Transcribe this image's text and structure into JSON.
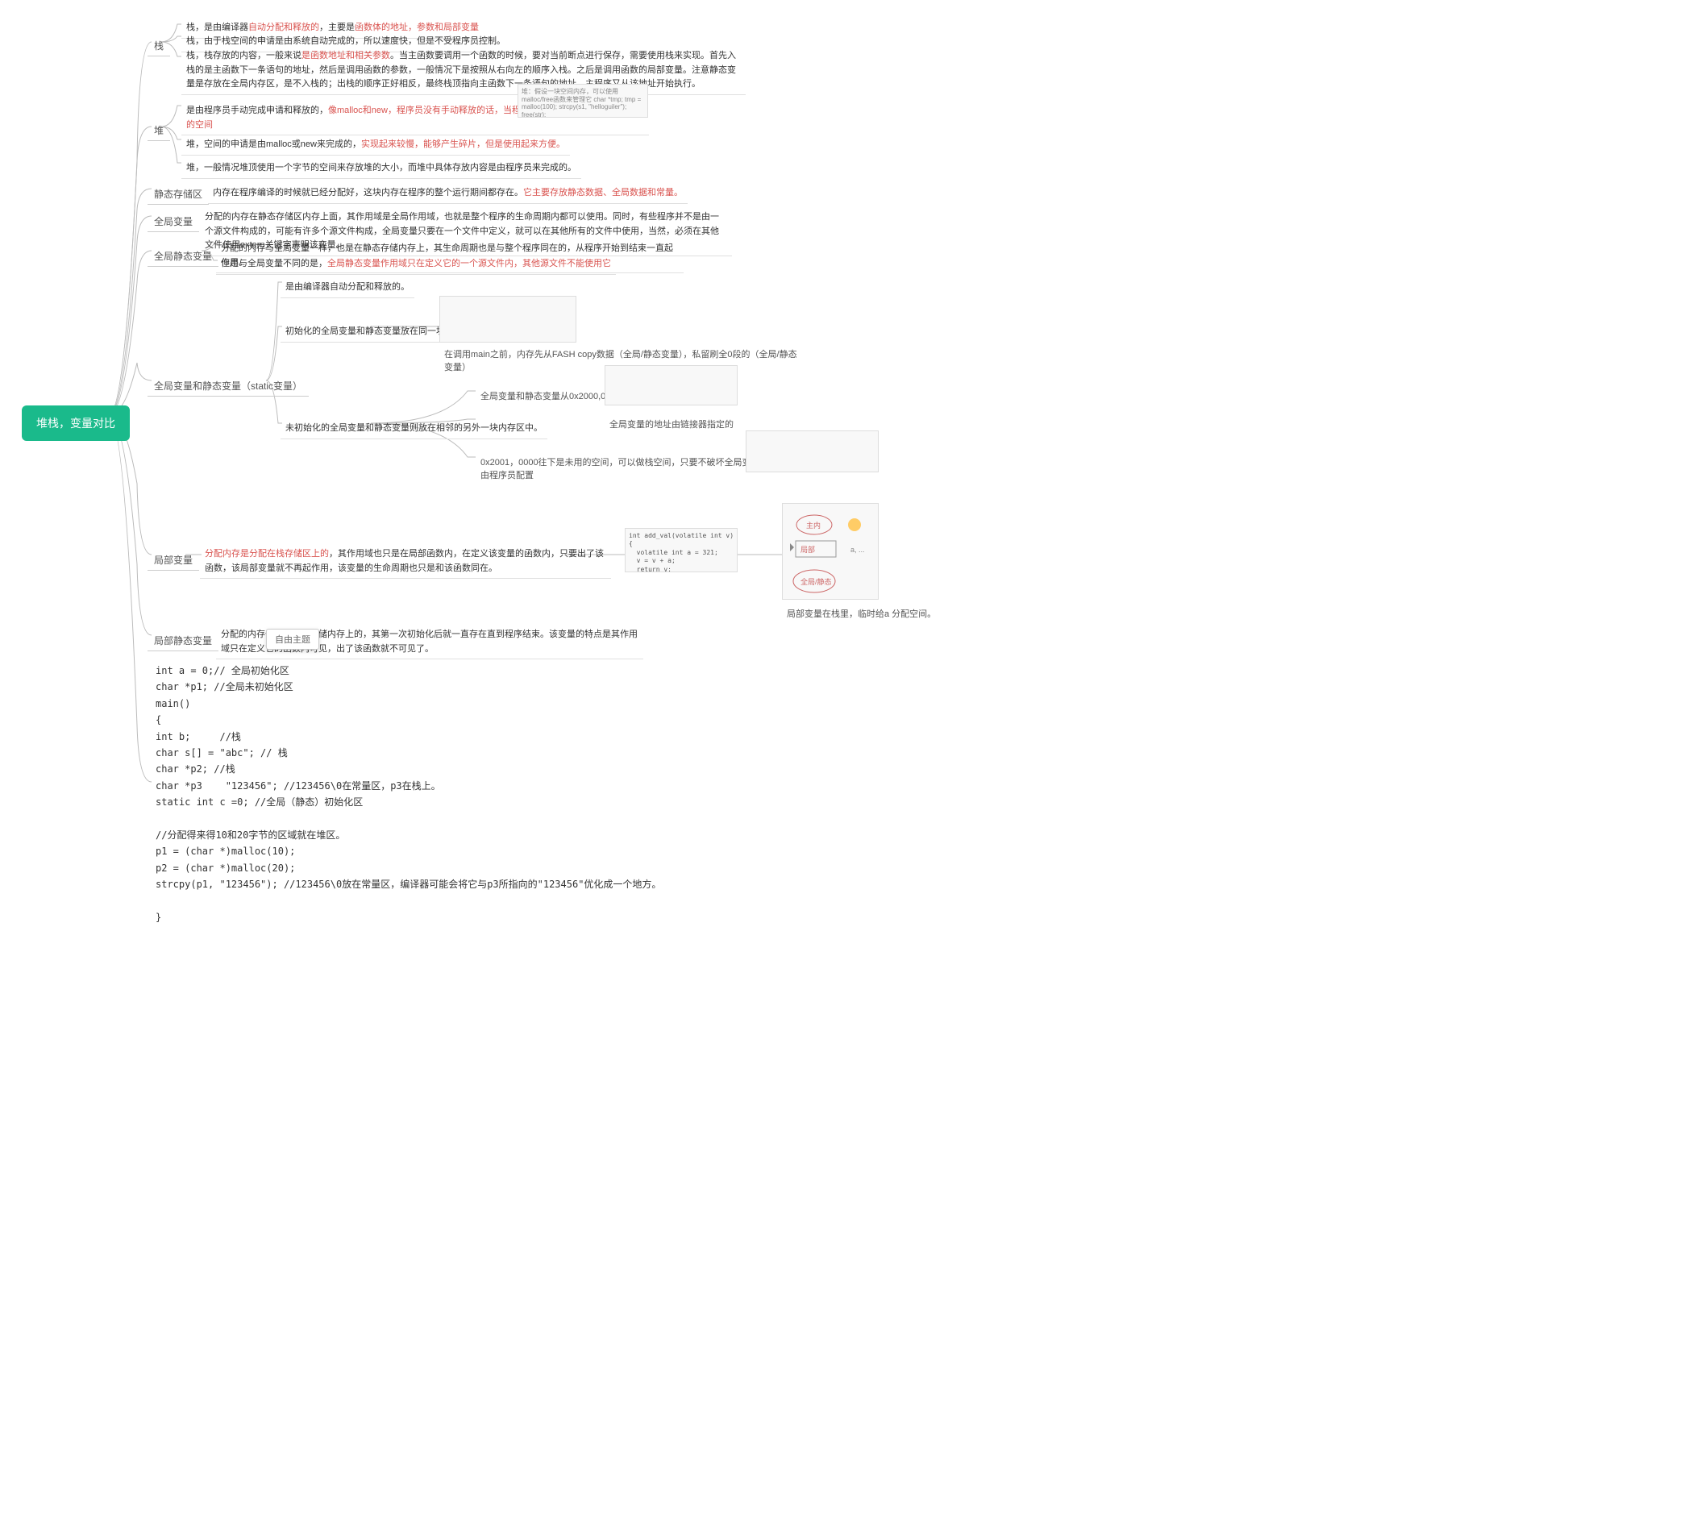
{
  "root": "堆栈，变量对比",
  "b1": {
    "label": "栈",
    "n1": {
      "pre": "栈，是由编译器",
      "r": "自动分配和释放的",
      "mid": "，主要是",
      "r2": "函数体的地址，参数和局部变量"
    },
    "n2": "栈，由于栈空间的申请是由系统自动完成的，所以速度快，但是不受程序员控制。",
    "n3": {
      "pre": "栈，栈存放的内容，一般来说",
      "r": "是函数地址和相关参数",
      "post": "。当主函数要调用一个函数的时候，要对当前断点进行保存，需要使用栈来实现。首先入栈的是主函数下一条语句的地址，然后是调用函数的参数，一般情况下是按照从右向左的顺序入栈。之后是调用函数的局部变量。注意静态变量是存放在全局内存区，是不入栈的；出栈的顺序正好相反，最终栈顶指向主函数下一条语句的地址，主程序又从该地址开始执行。"
    }
  },
  "b2": {
    "label": "堆",
    "n1": {
      "pre": "是由程序员手动完成申请和释放的，",
      "r": "像malloc和new，程序员没有手动释放的话，当程序结束时由系统释放没有释放的空间"
    },
    "n2": {
      "pre": "堆，空间的申请是由malloc或new来完成的，",
      "r": "实现起来较慢，能够产生碎片，但是使用起来方便。"
    },
    "n3": "堆，一般情况堆顶使用一个字节的空间来存放堆的大小，而堆中具体存放内容是由程序员来完成的。",
    "img": "堆：假设一块空间内存，可以使用malloc/free函数来管理它\\nchar *tmp;\\ntmp = malloc(100);\\nstrcpy(s1, \"helloguiler\");\\nfree(str);"
  },
  "b3": {
    "label": "静态存储区",
    "n1": {
      "pre": "内存在程序编译的时候就已经分配好，这块内存在程序的整个运行期间都存在。",
      "r": "它主要存放静态数据、全局数据和常量。"
    }
  },
  "b4": {
    "label": "全局变量",
    "n1": "分配的内存在静态存储区内存上面，其作用域是全局作用域，也就是整个程序的生命周期内都可以使用。同时，有些程序并不是由一个源文件构成的，可能有许多个源文件构成，全局变量只要在一个文件中定义，就可以在其他所有的文件中使用，当然，必须在其他文件使用extern关键字声明该变量。"
  },
  "b5": {
    "label": "全局静态变量",
    "n1": "分配的内存与全局变量一样，也是在静态存储内存上，其生命周期也是与整个程序同在的，从程序开始到结束一直起作用。",
    "n2": {
      "pre": "但是与全局变量不同的是，",
      "r": "全局静态变量作用域只在定义它的一个源文件内，其他源文件不能使用它"
    }
  },
  "b6": {
    "label": "全局变量和静态变量（static变量）",
    "n1": "是由编译器自动分配和释放的。",
    "n2": "初始化的全局变量和静态变量放在同一块内存区中",
    "n2a": "在调用main之前，内存先从FASH copy数据（全局/静态变量），私留刷全0段的（全局/静态变量）",
    "n3": "未初始化的全局变量和静态变量则放在相邻的另外一块内存区中。",
    "n3a": "全局变量和静态变量从0x2000,000开始存",
    "n3b": "全局变量的地址由链接器指定的",
    "n3c": "0x2001，0000往下是未用的空间，可以做栈空间，只要不破坏全局变量，地址由程序员配置"
  },
  "b7": {
    "label": "局部变量",
    "n1": {
      "r": "分配内存是分配在栈存储区上的",
      "post": "，其作用域也只是在局部函数内，在定义该变量的函数内，只要出了该函数，该局部变量就不再起作用，该变量的生命周期也只是和该函数同在。"
    },
    "caption": "局部变量在栈里，临时给a 分配空间。",
    "code": "int add_val(volatile int v)\\n{\\n  volatile int a = 321;\\n  v = v + a;\\n  return v;\\n}"
  },
  "b8": {
    "label": "局部静态变量",
    "n1": "分配的内存也是在静态存储内存上的，其第一次初始化后就一直存在直到程序结束。该变量的特点是其作用域只在定义它的函数内可见，出了该函数就不可见了。",
    "tooltip": "自由主题"
  },
  "code": "int a = 0;// 全局初始化区\nchar *p1; //全局未初始化区\nmain()\n{\nint b;     //栈\nchar s[] = \"abc\"; // 栈\nchar *p2; //栈\nchar *p3    \"123456\"; //123456\\0在常量区，p3在栈上。\nstatic int c =0; //全局（静态）初始化区\n\n//分配得来得10和20字节的区域就在堆区。\np1 = (char *)malloc(10);\np2 = (char *)malloc(20);\nstrcpy(p1, \"123456\"); //123456\\0放在常量区，编译器可能会将它与p3所指向的\"123456\"优化成一个地方。\n\n}"
}
